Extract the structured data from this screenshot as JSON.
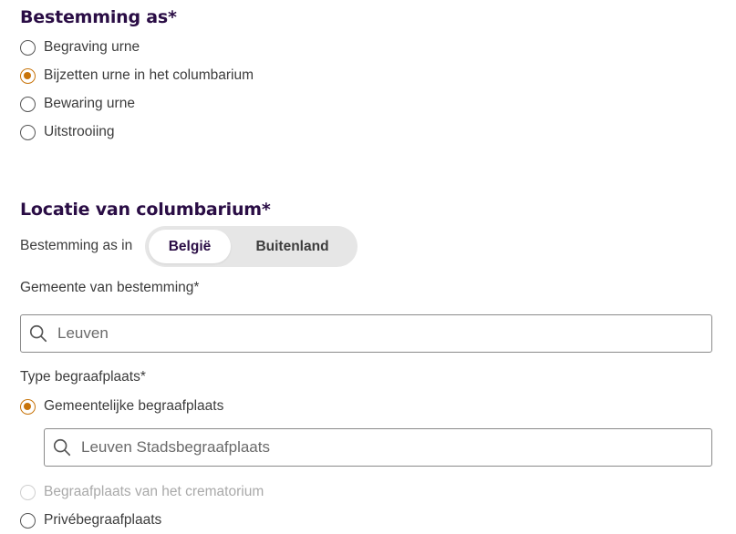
{
  "section_bestemming": {
    "title": "Bestemming as*",
    "options": [
      {
        "label": "Begraving urne",
        "checked": false
      },
      {
        "label": "Bijzetten urne in het columbarium",
        "checked": true
      },
      {
        "label": "Bewaring urne",
        "checked": false
      },
      {
        "label": "Uitstrooiing",
        "checked": false
      }
    ]
  },
  "section_locatie": {
    "title": "Locatie van columbarium*",
    "toggle_label": "Bestemming as in",
    "toggle_options": [
      "België",
      "Buitenland"
    ],
    "toggle_selected": "België",
    "gemeente_label": "Gemeente van bestemming*",
    "gemeente_value": "Leuven",
    "type_label": "Type begraafplaats*",
    "type_options": [
      {
        "label": "Gemeentelijke begraafplaats",
        "checked": true,
        "disabled": false
      },
      {
        "label": "Begraafplaats van het crematorium",
        "checked": false,
        "disabled": true
      },
      {
        "label": "Privébegraafplaats",
        "checked": false,
        "disabled": false
      }
    ],
    "begraafplaats_value": "Leuven Stadsbegraafplaats"
  },
  "colors": {
    "heading": "#2a0d45",
    "radio_checked": "#c8740a",
    "toggle_bg": "#e6e6e6"
  }
}
